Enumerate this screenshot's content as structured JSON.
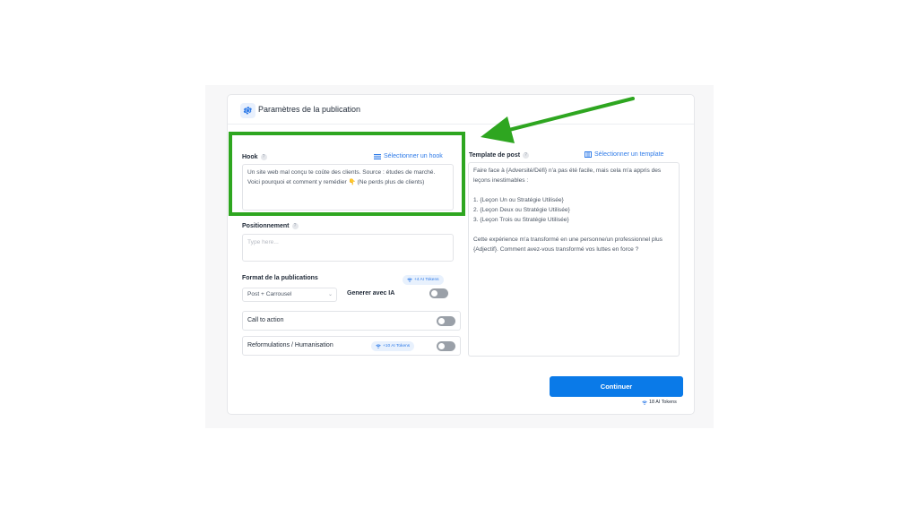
{
  "header": {
    "title": "Paramètres de la publication",
    "icon": "gear-icon"
  },
  "hook": {
    "label": "Hook",
    "select_link": "Sélectionner un hook",
    "value": "Un site web mal conçu te coûte des clients. Source : études de marché. Voici pourquoi et comment y remédier 👇 (Ne perds plus de clients)"
  },
  "positionnement": {
    "label": "Positionnement",
    "placeholder": "Type here..."
  },
  "format": {
    "label": "Format de la publications",
    "tokens_badge": "+4 AI Tokens",
    "selected": "Post + Carrousel",
    "ai_label": "Generer avec IA"
  },
  "cta": {
    "label": "Call to action"
  },
  "reformulations": {
    "label": "Reformulations / Humanisation",
    "tokens_badge": "+10 AI Tokens"
  },
  "template": {
    "label": "Template de post",
    "select_link": "Sélectionner un template",
    "value": "Faire face à {Adversité/Défi} n'a pas été facile, mais cela m'a appris des leçons inestimables :\n\n1. {Leçon Un ou Stratégie Utilisée}\n2. {Leçon Deux ou Stratégie Utilisée}\n3. {Leçon Trois ou Stratégie Utilisée}\n\nCette expérience m'a transformé en une personne/un professionnel plus {Adjectif}. Comment avez-vous transformé vos luttes en force ?"
  },
  "actions": {
    "continue_label": "Continuer",
    "total_tokens": "18 AI Tokens"
  },
  "colors": {
    "accent": "#0a7ae8",
    "link": "#2f7be8",
    "highlight": "#2ea620",
    "toggle_off": "#9aa0a8"
  }
}
